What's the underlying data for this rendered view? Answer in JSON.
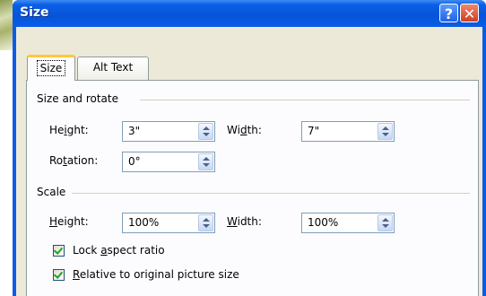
{
  "window": {
    "title": "Size",
    "help_glyph": "?",
    "close_glyph": "✕"
  },
  "tabs": [
    {
      "label": "Size",
      "active": true
    },
    {
      "label": "Alt Text",
      "active": false
    }
  ],
  "size_rotate": {
    "heading": "Size and rotate",
    "height_label": "Height:",
    "height_value": "3\"",
    "width_label": "Width:",
    "width_value": "7\"",
    "rotation_label": "Rotation:",
    "rotation_value": "0°"
  },
  "scale": {
    "heading": "Scale",
    "height_label": "Height:",
    "height_value": "100%",
    "width_label": "Width:",
    "width_value": "100%"
  },
  "checkboxes": {
    "lock_aspect": {
      "label": "Lock aspect ratio",
      "checked": true
    },
    "relative_original": {
      "label": "Relative to original picture size",
      "checked": true
    }
  },
  "colors": {
    "title_bar": "#0a5ce8",
    "dialog_bg": "#ece9d8",
    "panel_bg": "#fcfcfe",
    "active_tab_accent": "#ffc83c"
  }
}
